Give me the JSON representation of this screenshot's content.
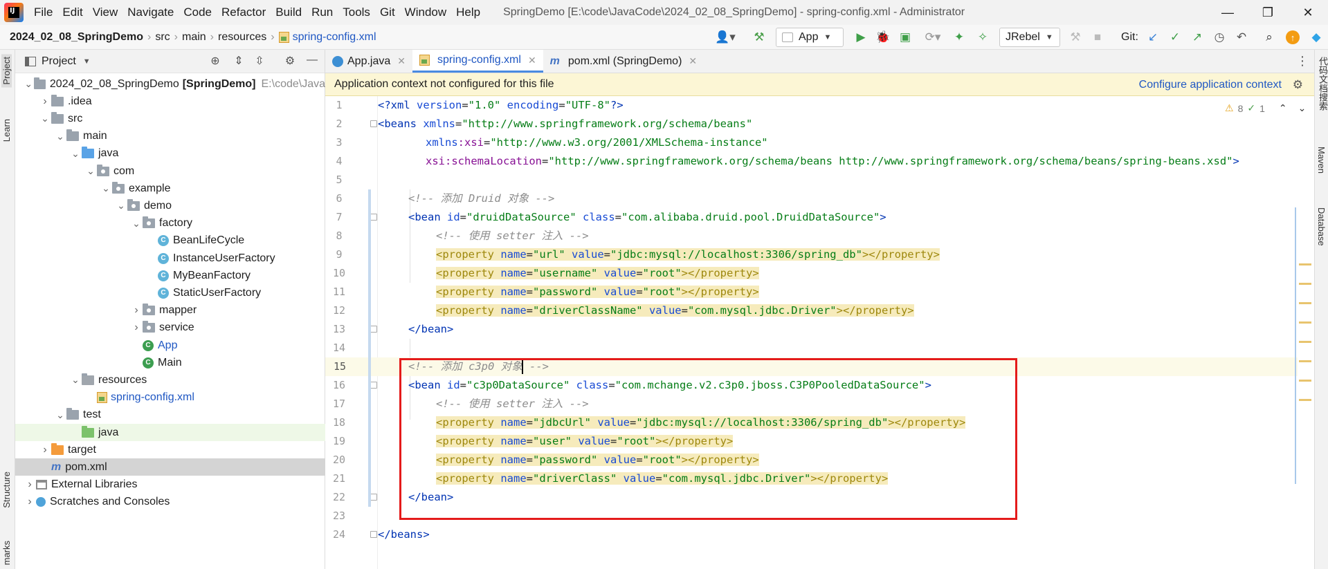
{
  "menu": {
    "items": [
      "File",
      "Edit",
      "View",
      "Navigate",
      "Code",
      "Refactor",
      "Build",
      "Run",
      "Tools",
      "Git",
      "Window",
      "Help"
    ],
    "window_title": "SpringDemo [E:\\code\\JavaCode\\2024_02_08_SpringDemo] - spring-config.xml - Administrator"
  },
  "breadcrumb": {
    "project": "2024_02_08_SpringDemo",
    "parts": [
      "src",
      "main",
      "resources"
    ],
    "file": "spring-config.xml"
  },
  "toolbar": {
    "run_config": "App",
    "jrebel": "JRebel",
    "git_label": "Git:"
  },
  "left_strip": {
    "project_tab": "Project",
    "learn_tab": "Learn",
    "structure_tab": "Structure",
    "bookmarks_tab": "marks"
  },
  "project_panel": {
    "title": "Project",
    "tree": [
      {
        "label": "2024_02_08_SpringDemo",
        "suffix": "[SpringDemo]",
        "path": "E:\\code\\Java",
        "depth": 0,
        "arrow": "down",
        "icon": "folder"
      },
      {
        "label": ".idea",
        "depth": 1,
        "arrow": "right",
        "icon": "folder"
      },
      {
        "label": "src",
        "depth": 1,
        "arrow": "down",
        "icon": "folder"
      },
      {
        "label": "main",
        "depth": 2,
        "arrow": "down",
        "icon": "folder"
      },
      {
        "label": "java",
        "depth": 3,
        "arrow": "down",
        "icon": "folder-blue"
      },
      {
        "label": "com",
        "depth": 4,
        "arrow": "down",
        "icon": "package"
      },
      {
        "label": "example",
        "depth": 5,
        "arrow": "down",
        "icon": "package"
      },
      {
        "label": "demo",
        "depth": 6,
        "arrow": "down",
        "icon": "package"
      },
      {
        "label": "factory",
        "depth": 7,
        "arrow": "down",
        "icon": "package"
      },
      {
        "label": "BeanLifeCycle",
        "depth": 8,
        "arrow": "none",
        "icon": "class"
      },
      {
        "label": "InstanceUserFactory",
        "depth": 8,
        "arrow": "none",
        "icon": "class"
      },
      {
        "label": "MyBeanFactory",
        "depth": 8,
        "arrow": "none",
        "icon": "class"
      },
      {
        "label": "StaticUserFactory",
        "depth": 8,
        "arrow": "none",
        "icon": "class"
      },
      {
        "label": "mapper",
        "depth": 7,
        "arrow": "right",
        "icon": "package"
      },
      {
        "label": "service",
        "depth": 7,
        "arrow": "right",
        "icon": "package"
      },
      {
        "label": "App",
        "depth": 7,
        "arrow": "none",
        "icon": "class-main",
        "color": "blue"
      },
      {
        "label": "Main",
        "depth": 7,
        "arrow": "none",
        "icon": "class-main"
      },
      {
        "label": "resources",
        "depth": 3,
        "arrow": "down",
        "icon": "folder-res"
      },
      {
        "label": "spring-config.xml",
        "depth": 4,
        "arrow": "none",
        "icon": "xml",
        "color": "blue"
      },
      {
        "label": "test",
        "depth": 2,
        "arrow": "down",
        "icon": "folder"
      },
      {
        "label": "java",
        "depth": 3,
        "arrow": "none",
        "icon": "folder-green",
        "state": "highlight"
      },
      {
        "label": "target",
        "depth": 1,
        "arrow": "right",
        "icon": "folder-orange"
      },
      {
        "label": "pom.xml",
        "depth": 1,
        "arrow": "none",
        "icon": "maven",
        "state": "selected"
      },
      {
        "label": "External Libraries",
        "depth": 0,
        "arrow": "right",
        "icon": "library"
      },
      {
        "label": "Scratches and Consoles",
        "depth": 0,
        "arrow": "right",
        "icon": "scratch"
      }
    ]
  },
  "editor": {
    "tabs": [
      {
        "label": "App.java",
        "icon": "class",
        "active": false
      },
      {
        "label": "spring-config.xml",
        "icon": "xml",
        "active": true
      },
      {
        "label": "pom.xml (SpringDemo)",
        "icon": "maven",
        "active": false
      }
    ],
    "notice": "Application context not configured for this file",
    "notice_link": "Configure application context",
    "inspections": {
      "warnings": "8",
      "weak": "1"
    },
    "line_numbers": [
      "1",
      "2",
      "3",
      "4",
      "5",
      "6",
      "7",
      "8",
      "9",
      "10",
      "11",
      "12",
      "13",
      "14",
      "15",
      "16",
      "17",
      "18",
      "19",
      "20",
      "21",
      "22",
      "23",
      "24"
    ],
    "code": {
      "l1": {
        "a": "<?xml ",
        "b": "version",
        "c": "=",
        "d": "\"1.0\"",
        "e": " encoding",
        "f": "=",
        "g": "\"UTF-8\"",
        "h": "?>"
      },
      "l2": {
        "a": "<beans ",
        "b": "xmlns",
        "c": "=",
        "d": "\"http://www.springframework.org/schema/beans\""
      },
      "l3": {
        "a": "xmlns",
        "b": ":xsi",
        "c": "=",
        "d": "\"http://www.w3.org/2001/XMLSchema-instance\""
      },
      "l4": {
        "a": "xsi",
        "b": ":schemaLocation",
        "c": "=",
        "d": "\"http://www.springframework.org/schema/beans http://www.springframework.org/schema/beans/spring-beans.xsd\"",
        "e": ">"
      },
      "l6": "<!-- 添加 Druid 对象 -->",
      "l7": {
        "a": "<bean ",
        "b": "id",
        "c": "=",
        "d": "\"druidDataSource\"",
        "e": " class",
        "f": "=",
        "g": "\"com.alibaba.druid.pool.DruidDataSource\"",
        "h": ">"
      },
      "l8": "<!-- 使用 setter 注入 -->",
      "l9": {
        "a": "<property ",
        "b": "name",
        "c": "=",
        "d": "\"url\"",
        "e": " value",
        "f": "=",
        "g": "\"jdbc:mysql://localhost:3306/spring_db\"",
        "h": "></property>"
      },
      "l10": {
        "a": "<property ",
        "b": "name",
        "c": "=",
        "d": "\"username\"",
        "e": " value",
        "f": "=",
        "g": "\"root\"",
        "h": "></property>"
      },
      "l11": {
        "a": "<property ",
        "b": "name",
        "c": "=",
        "d": "\"password\"",
        "e": " value",
        "f": "=",
        "g": "\"root\"",
        "h": "></property>"
      },
      "l12": {
        "a": "<property ",
        "b": "name",
        "c": "=",
        "d": "\"driverClassName\"",
        "e": " value",
        "f": "=",
        "g": "\"com.mysql.jdbc.Driver\"",
        "h": "></property>"
      },
      "l13": "</bean>",
      "l15a": "<!-- 添加 c3p0 对象",
      "l15b": " -->",
      "l16": {
        "a": "<bean ",
        "b": "id",
        "c": "=",
        "d": "\"c3p0DataSource\"",
        "e": " class",
        "f": "=",
        "g": "\"com.mchange.v2.c3p0.jboss.C3P0PooledDataSource\"",
        "h": ">"
      },
      "l17": "<!-- 使用 setter 注入 -->",
      "l18": {
        "a": "<property ",
        "b": "name",
        "c": "=",
        "d": "\"jdbcUrl\"",
        "e": " value",
        "f": "=",
        "g": "\"jdbc:mysql://localhost:3306/spring_db\"",
        "h": "></property>"
      },
      "l19": {
        "a": "<property ",
        "b": "name",
        "c": "=",
        "d": "\"user\"",
        "e": " value",
        "f": "=",
        "g": "\"root\"",
        "h": "></property>"
      },
      "l20": {
        "a": "<property ",
        "b": "name",
        "c": "=",
        "d": "\"password\"",
        "e": " value",
        "f": "=",
        "g": "\"root\"",
        "h": "></property>"
      },
      "l21": {
        "a": "<property ",
        "b": "name",
        "c": "=",
        "d": "\"driverClass\"",
        "e": " value",
        "f": "=",
        "g": "\"com.mysql.jdbc.Driver\"",
        "h": "></property>"
      },
      "l22": "</bean>",
      "l24": "</beans>"
    }
  },
  "right_strip": {
    "search_tab": "代码文档搜索",
    "maven_tab": "Maven",
    "database_tab": "Database"
  },
  "colors": {
    "annotation_box": "#e41b1b",
    "link": "#1f57c3",
    "notice_bg": "#fcf6d5"
  }
}
